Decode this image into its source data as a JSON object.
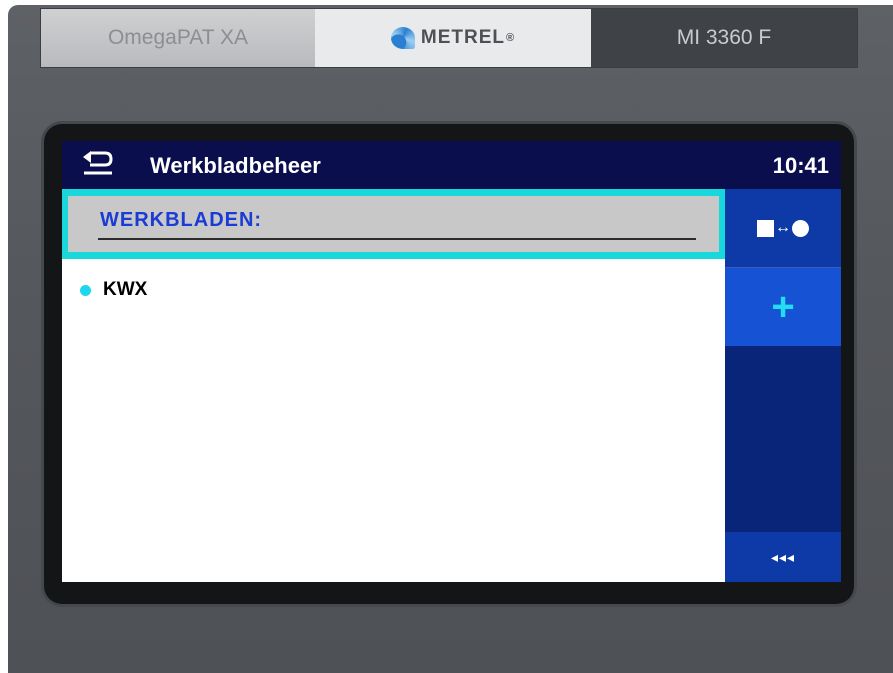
{
  "device": {
    "label_left": "OmegaPAT XA",
    "brand": "METREL",
    "brand_mark": "®",
    "model": "MI 3360 F"
  },
  "titlebar": {
    "title": "Werkbladbeheer",
    "time": "10:41",
    "back_icon": "return-arrow-icon"
  },
  "list": {
    "header": "WERKBLADEN:",
    "items": [
      {
        "label": "KWX"
      }
    ]
  },
  "sidebar": {
    "buttons": [
      {
        "name": "toggle-view",
        "icon": "square-arrow-circle-icon"
      },
      {
        "name": "add",
        "icon": "plus-icon",
        "glyph": "+"
      },
      {
        "name": "back",
        "icon": "triple-triangle-left-icon",
        "glyph": "◂◂◂"
      }
    ]
  },
  "colors": {
    "titlebar_bg": "#0a0e4d",
    "sidebar_bg": "#08257a",
    "highlight": "#18d8dc",
    "header_text": "#1a3bd6",
    "bullet": "#1ed6ee"
  }
}
